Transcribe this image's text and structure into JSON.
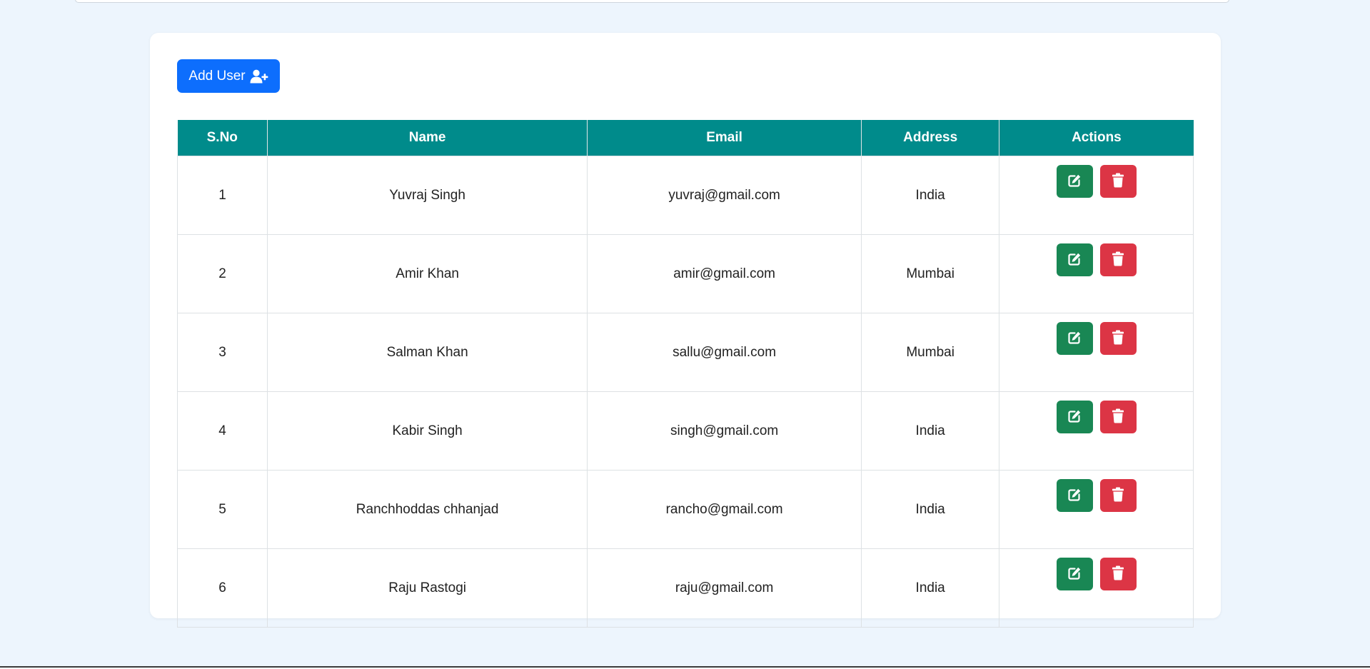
{
  "colors": {
    "page_background": "#edf5fd",
    "primary": "#0d6efd",
    "table_header": "#008b8b",
    "edit": "#198754",
    "delete": "#dc3545"
  },
  "toolbar": {
    "add_label": "Add User",
    "add_icon": "user-plus-icon"
  },
  "table": {
    "headers": {
      "sno": "S.No",
      "name": "Name",
      "email": "Email",
      "address": "Address",
      "actions": "Actions"
    },
    "rows": [
      {
        "sno": "1",
        "name": "Yuvraj Singh",
        "email": "yuvraj@gmail.com",
        "address": "India"
      },
      {
        "sno": "2",
        "name": "Amir Khan",
        "email": "amir@gmail.com",
        "address": "Mumbai"
      },
      {
        "sno": "3",
        "name": "Salman Khan",
        "email": "sallu@gmail.com",
        "address": "Mumbai"
      },
      {
        "sno": "4",
        "name": "Kabir Singh",
        "email": "singh@gmail.com",
        "address": "India"
      },
      {
        "sno": "5",
        "name": "Ranchhoddas chhanjad",
        "email": "rancho@gmail.com",
        "address": "India"
      },
      {
        "sno": "6",
        "name": "Raju Rastogi",
        "email": "raju@gmail.com",
        "address": "India"
      }
    ],
    "edit_icon": "edit-icon",
    "delete_icon": "trash-icon"
  }
}
